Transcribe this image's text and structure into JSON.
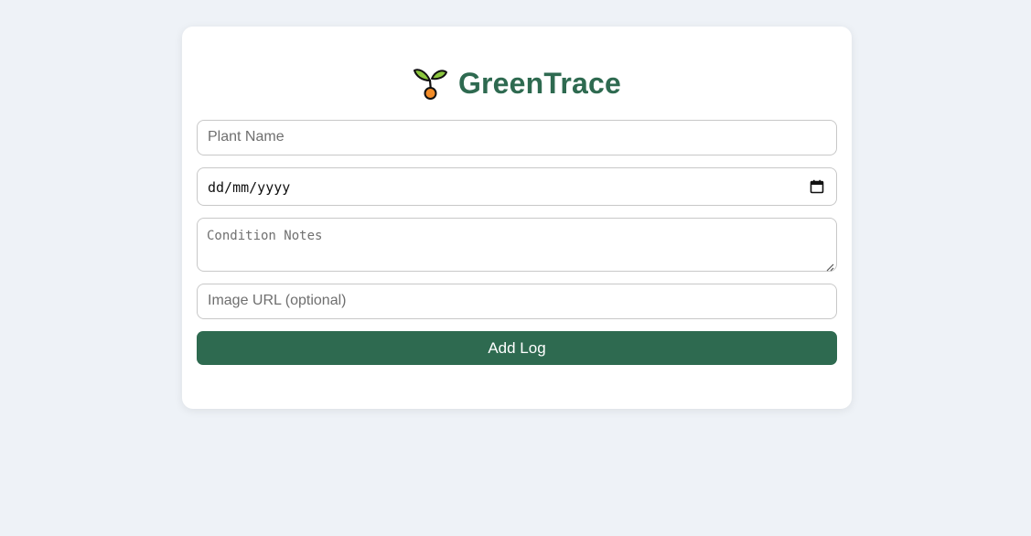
{
  "app": {
    "title": "GreenTrace",
    "logo_icon": "seedling-icon",
    "brand_color": "#2e6a50",
    "background_color": "#eef2f7"
  },
  "form": {
    "plant_name": {
      "value": "",
      "placeholder": "Plant Name"
    },
    "date": {
      "value": "",
      "display": "dd/mm/yyyy",
      "icon": "calendar-icon"
    },
    "condition_notes": {
      "value": "",
      "placeholder": "Condition Notes"
    },
    "image_url": {
      "value": "",
      "placeholder": "Image URL (optional)"
    },
    "submit_label": "Add Log"
  }
}
